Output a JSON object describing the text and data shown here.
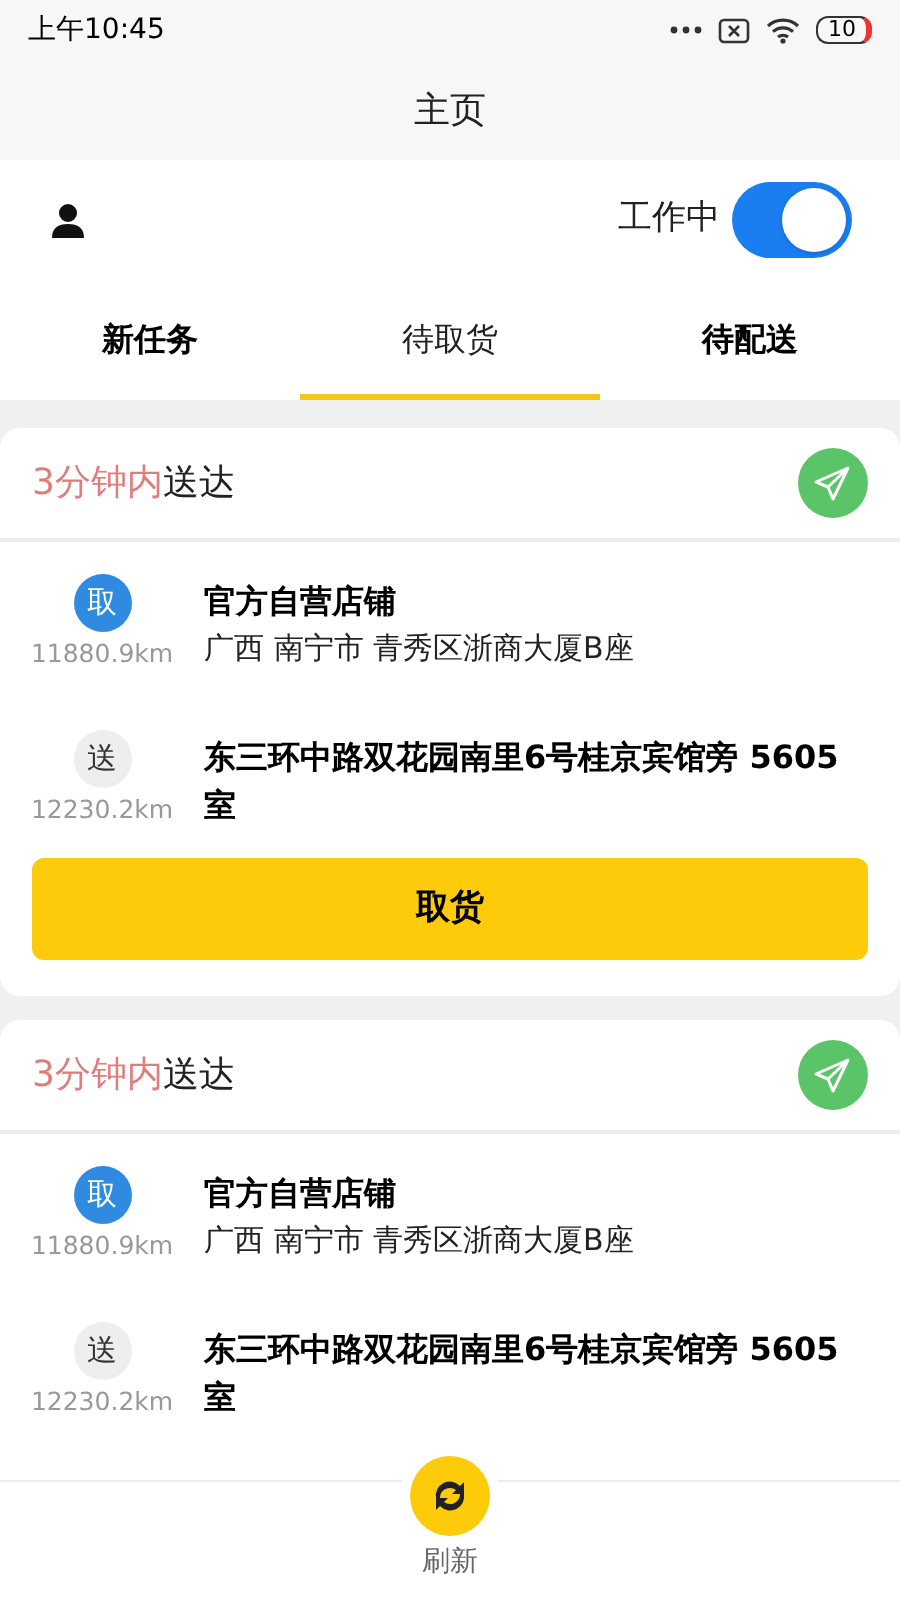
{
  "status_bar": {
    "time": "上午10:45",
    "battery": "10"
  },
  "title": "主页",
  "work_toggle": {
    "label": "工作中",
    "on": true
  },
  "tabs": [
    {
      "label": "新任务",
      "selected": false
    },
    {
      "label": "待取货",
      "selected": true
    },
    {
      "label": "待配送",
      "selected": false
    }
  ],
  "orders": [
    {
      "deadline": {
        "highlight": "3分钟内",
        "rest": "送达"
      },
      "stops": [
        {
          "kind": "pickup",
          "badge": "取",
          "distance": "11880.9km",
          "name": "官方自营店铺",
          "address": "广西 南宁市 青秀区浙商大厦B座"
        },
        {
          "kind": "dropoff",
          "badge": "送",
          "distance": "12230.2km",
          "name": "东三环中路双花园南里6号桂京宾馆旁 5605室"
        }
      ],
      "action": "取货"
    },
    {
      "deadline": {
        "highlight": "3分钟内",
        "rest": "送达"
      },
      "stops": [
        {
          "kind": "pickup",
          "badge": "取",
          "distance": "11880.9km",
          "name": "官方自营店铺",
          "address": "广西 南宁市 青秀区浙商大厦B座"
        },
        {
          "kind": "dropoff",
          "badge": "送",
          "distance": "12230.2km",
          "name": "东三环中路双花园南里6号桂京宾馆旁 5605室"
        }
      ]
    }
  ],
  "refresh": {
    "label": "刷新"
  }
}
